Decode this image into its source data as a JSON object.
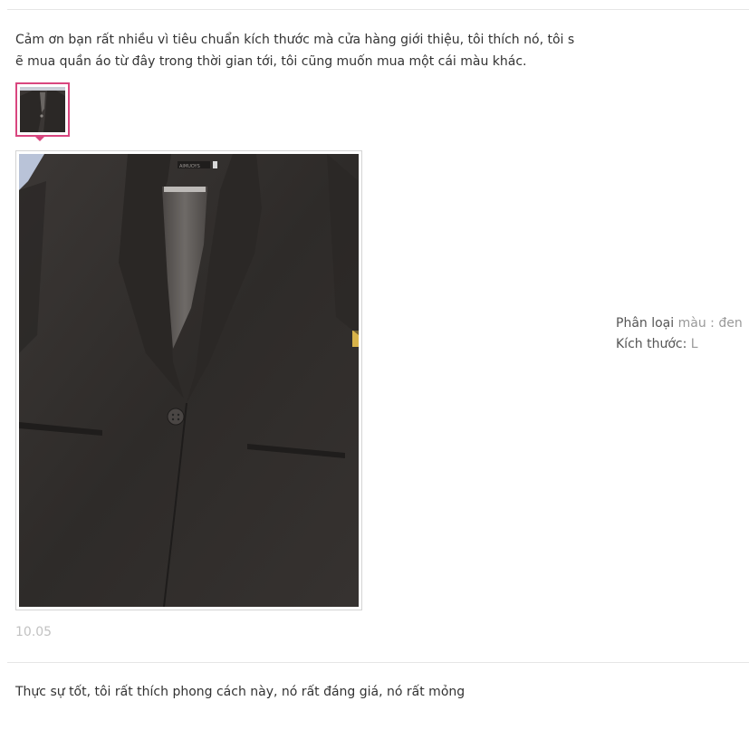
{
  "review1": {
    "text": "Cảm ơn bạn rất nhiều vì tiêu chuẩn kích thước mà cửa hàng giới thiệu, tôi thích nó, tôi sẽ mua quần áo từ đây trong thời gian tới, tôi cũng muốn mua một cái màu khác.",
    "variant_label": "Phân loại",
    "variant_value": "màu : đen",
    "size_label": "Kích thước:",
    "size_value": "L",
    "date": "10.05",
    "photo_label_text": "AIMUOYS"
  },
  "review2": {
    "text": "Thực sự tốt, tôi rất thích phong cách này, nó rất đáng giá, nó rất mỏng"
  },
  "colors": {
    "thumb_border": "#d9467f",
    "divider": "#e6e6e6",
    "muted": "#999999",
    "date": "#c2c2c2"
  }
}
